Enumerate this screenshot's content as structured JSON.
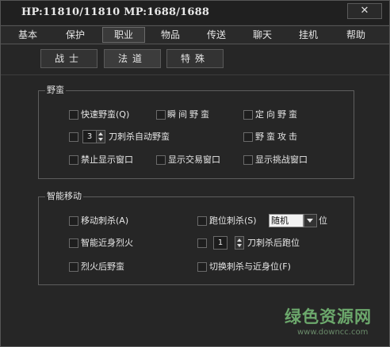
{
  "titlebar": {
    "stats": "HP:11810/11810  MP:1688/1688",
    "close_symbol": "✕"
  },
  "tabs": [
    "基本",
    "保护",
    "职业",
    "物品",
    "传送",
    "聊天",
    "挂机",
    "帮助"
  ],
  "selected_tab": "职业",
  "subtabs": [
    "战士",
    "法道",
    "特殊"
  ],
  "selected_subtab": "法道",
  "group_yeman": {
    "title": "野蛮",
    "quick_yeman": "快速野蛮(Q)",
    "shunjian_yeman": "瞬间野蛮",
    "dingxiang_yeman": "定向野蛮",
    "auto_yeman_value": "3",
    "auto_yeman_label": "刀刺杀自动野蛮",
    "yeman_attack": "野蛮攻击",
    "ban_display_window": "禁止显示窗口",
    "show_trade_window": "显示交易窗口",
    "show_challenge_window": "显示挑战窗口"
  },
  "group_move": {
    "title": "智能移动",
    "move_cisha": "移动刺杀(A)",
    "pao_wei_cisha": "跑位刺杀(S)",
    "position_select": "随机",
    "position_suffix": "位",
    "smart_near_liehuo": "智能近身烈火",
    "after_value": "1",
    "after_label": "刀刺杀后跑位",
    "after_liehuo_yeman": "烈火后野蛮",
    "switch_cisha_near": "切换刺杀与近身位(F)"
  },
  "watermark": {
    "main": "绿色资源网",
    "url": "www.downcc.com"
  }
}
